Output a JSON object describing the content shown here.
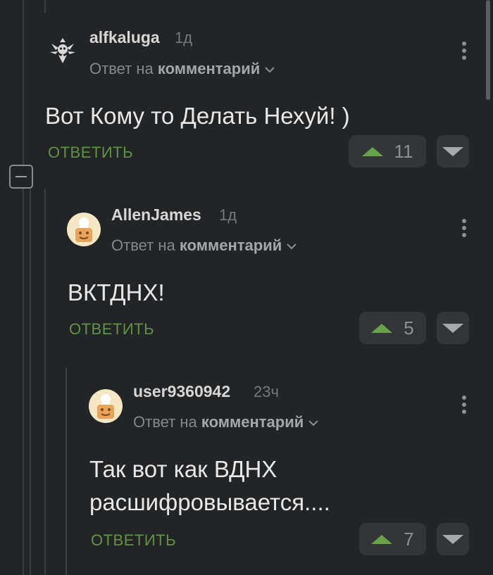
{
  "comments": [
    {
      "username": "alfkaluga",
      "time": "1д",
      "reply_prefix": "Ответ на",
      "reply_target": "комментарий",
      "text": "Вот Кому то Делать Нехуй! )",
      "reply_label": "ОТВЕТИТЬ",
      "rating": "11",
      "avatar": "tribal-skull-avatar"
    },
    {
      "username": "AllenJames",
      "time": "1д",
      "reply_prefix": "Ответ на",
      "reply_target": "комментарий",
      "text": "ВКТДНХ!",
      "reply_label": "ОТВЕТИТЬ",
      "rating": "5",
      "avatar": "chef-avatar"
    },
    {
      "username": "user9360942",
      "time": "23ч",
      "reply_prefix": "Ответ на",
      "reply_target": "комментарий",
      "text": "Так вот как ВДНХ расшифровывается....",
      "reply_label": "ОТВЕТИТЬ",
      "rating": "7",
      "avatar": "chef-avatar"
    }
  ],
  "colors": {
    "background": "#232426",
    "reply_green": "#5f9444",
    "upvote_green": "#67a24a"
  }
}
